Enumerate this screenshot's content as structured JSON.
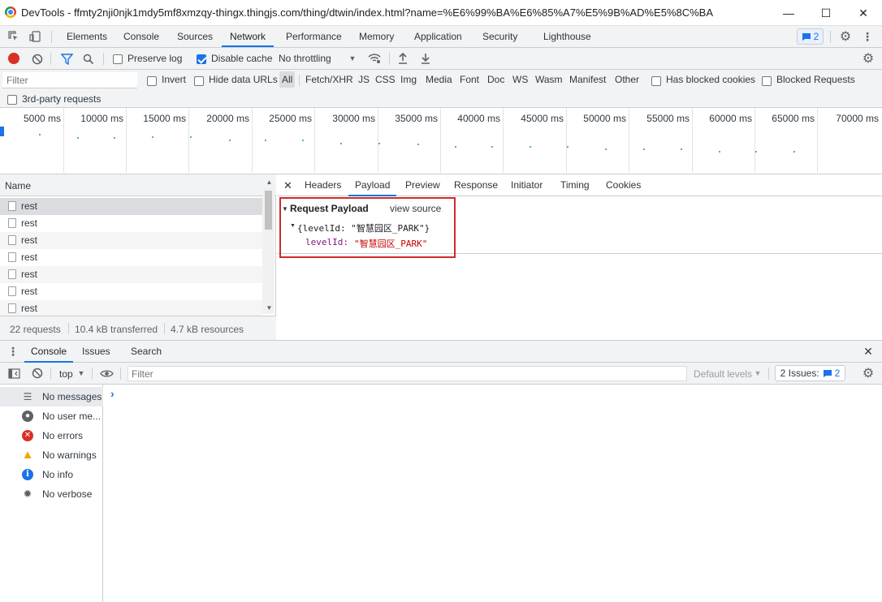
{
  "window": {
    "title": "DevTools - ffmty2nji0njk1mdy5mf8xmzqy-thingx.thingjs.com/thing/dtwin/index.html?name=%E6%99%BA%E6%85%A7%E5%9B%AD%E5%8C%BA",
    "minimize": "—",
    "maximize": "☐",
    "close": "✕"
  },
  "main_tabs": [
    "Elements",
    "Console",
    "Sources",
    "Network",
    "Performance",
    "Memory",
    "Application",
    "Security",
    "Lighthouse"
  ],
  "issues_count": "2",
  "network_toolbar": {
    "preserve_log": "Preserve log",
    "disable_cache": "Disable cache",
    "throttling": "No throttling"
  },
  "filter_bar": {
    "filter_placeholder": "Filter",
    "invert": "Invert",
    "hide_data_urls": "Hide data URLs",
    "types": [
      "All",
      "Fetch/XHR",
      "JS",
      "CSS",
      "Img",
      "Media",
      "Font",
      "Doc",
      "WS",
      "Wasm",
      "Manifest",
      "Other"
    ],
    "has_blocked_cookies": "Has blocked cookies",
    "blocked_requests": "Blocked Requests",
    "third_party": "3rd-party requests"
  },
  "timeline": {
    "ticks": [
      "5000 ms",
      "10000 ms",
      "15000 ms",
      "20000 ms",
      "25000 ms",
      "30000 ms",
      "35000 ms",
      "40000 ms",
      "45000 ms",
      "50000 ms",
      "55000 ms",
      "60000 ms",
      "65000 ms",
      "70000 ms"
    ]
  },
  "requests": {
    "header": "Name",
    "rows": [
      "rest",
      "rest",
      "rest",
      "rest",
      "rest",
      "rest",
      "rest"
    ],
    "status": {
      "count": "22 requests",
      "transferred": "10.4 kB transferred",
      "resources": "4.7 kB resources"
    }
  },
  "detail": {
    "close": "✕",
    "tabs": [
      "Headers",
      "Payload",
      "Preview",
      "Response",
      "Initiator",
      "Timing",
      "Cookies"
    ],
    "payload": {
      "title": "Request Payload",
      "view_source": "view source",
      "object_line": "{levelId: \"智慧园区_PARK\"}",
      "key": "levelId:",
      "value": "\"智慧园区_PARK\""
    }
  },
  "drawer": {
    "tabs": [
      "Console",
      "Issues",
      "Search"
    ],
    "context": "top",
    "filter_placeholder": "Filter",
    "default_levels": "Default levels",
    "issues_label": "2 Issues:",
    "issues_count": "2",
    "prompt": "›",
    "sidebar": [
      {
        "label": "No messages",
        "icon": "list-icon"
      },
      {
        "label": "No user me...",
        "icon": "user-icon"
      },
      {
        "label": "No errors",
        "icon": "error-icon"
      },
      {
        "label": "No warnings",
        "icon": "warning-icon"
      },
      {
        "label": "No info",
        "icon": "info-icon"
      },
      {
        "label": "No verbose",
        "icon": "bug-icon"
      }
    ]
  },
  "colors": {
    "accent": "#1a73e8",
    "record": "#d93025",
    "highlight_border": "#d12a2a",
    "payload_key": "#881280",
    "payload_value": "#c80000"
  }
}
